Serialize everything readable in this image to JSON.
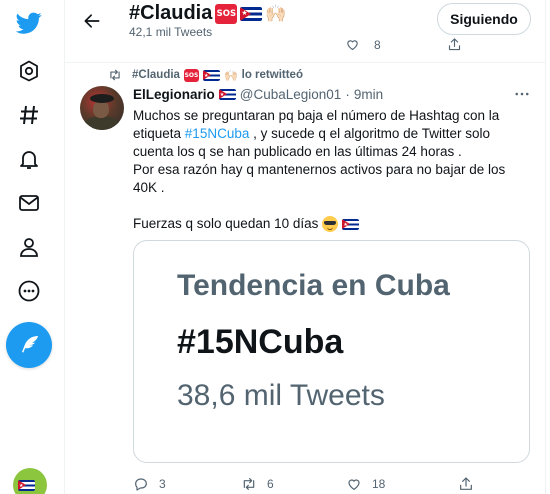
{
  "nav": {
    "items": [
      "twitter-logo",
      "explore-icon",
      "hashtag-icon",
      "notifications-icon",
      "messages-icon",
      "profile-icon",
      "more-icon"
    ],
    "compose_icon": "compose-icon",
    "accent_color": "#1d9bf0"
  },
  "header": {
    "title": "#Claudia",
    "subtitle": "42,1 mil Tweets",
    "follow_label": "Siguiendo"
  },
  "previous_tweet": {
    "like_count": "8"
  },
  "tweet": {
    "retweet_by": "#Claudia",
    "retweet_suffix": "lo retwitteó",
    "author_name": "ElLegionario",
    "handle": "@CubaLegion01",
    "separator": "·",
    "time": "9min",
    "text_line1": "Muchos se preguntaran pq baja el número de Hashtag con la",
    "text_line2_pre": "etiqueta ",
    "hashtag": "#15NCuba",
    "text_line2_post": " , y sucede q el algoritmo de Twitter solo",
    "text_line3": "cuenta los q se han publicado en las últimas 24 horas .",
    "text_line4": "Por esa razón hay q mantenernos activos para no bajar de los",
    "text_line5": "40K .",
    "text_line6": "Fuerzas q solo quedan 10 días",
    "card": {
      "title": "Tendencia en Cuba",
      "hashtag": "#15NCuba",
      "count": "38,6 mil Tweets"
    },
    "actions": {
      "replies": "3",
      "retweets": "6",
      "likes": "18"
    }
  },
  "emoji": {
    "sos": "SOS",
    "raised_hands": "🙌🏻",
    "flag": "cuba-flag"
  }
}
